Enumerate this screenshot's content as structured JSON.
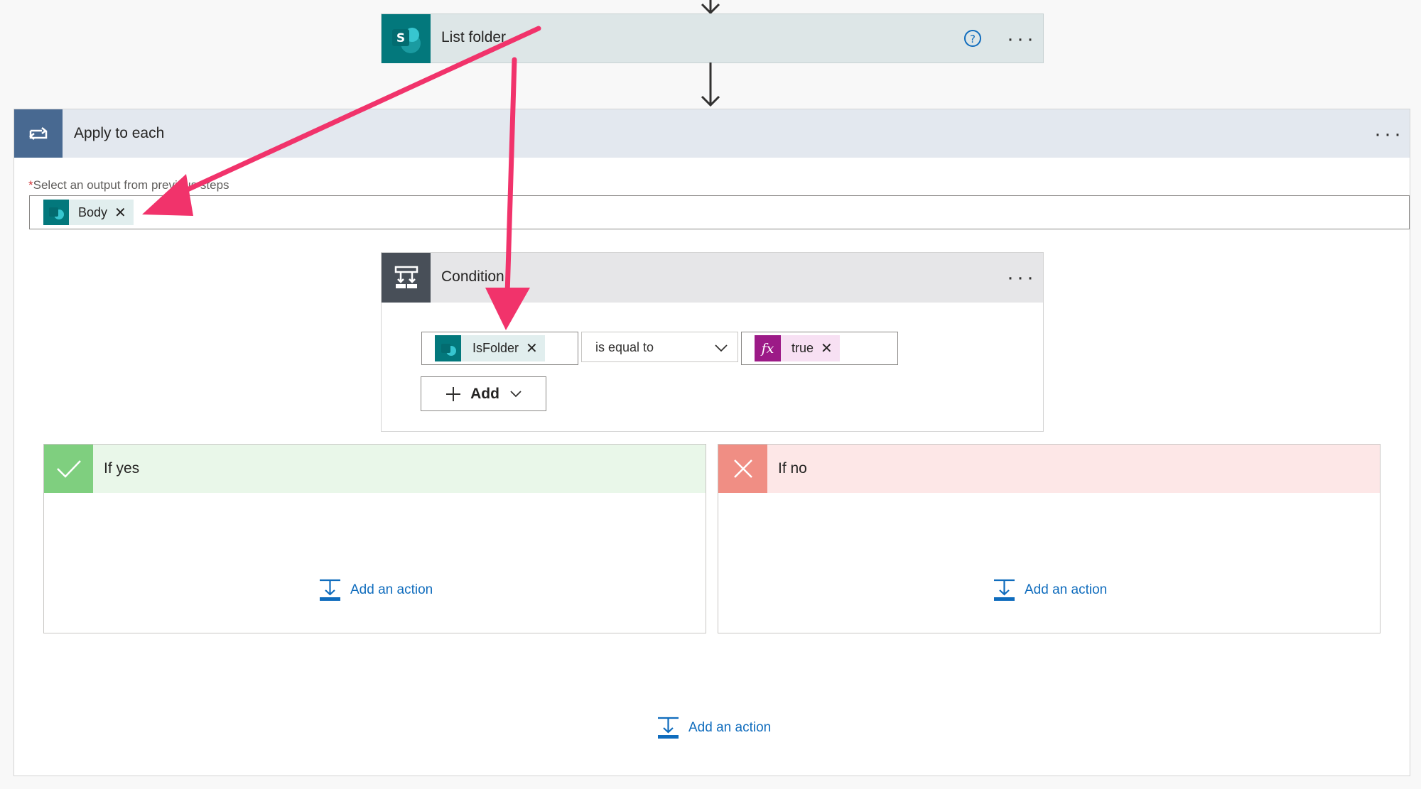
{
  "list_folder": {
    "title": "List folder",
    "logo_letter": "S"
  },
  "apply_to_each": {
    "title": "Apply to each",
    "field_label_required": "*",
    "field_label": "Select an output from previous steps",
    "token_label": "Body"
  },
  "condition": {
    "title": "Condition",
    "left_token": "IsFolder",
    "operator": "is equal to",
    "right_token": "true",
    "fx_glyph": "fx",
    "add_label": "Add"
  },
  "if_yes": {
    "title": "If yes",
    "add_action": "Add an action"
  },
  "if_no": {
    "title": "If no",
    "add_action": "Add an action"
  },
  "outer_add_action": "Add an action",
  "icons": {
    "sharepoint": "sharepoint-icon",
    "loop": "loop-icon",
    "condition": "condition-icon",
    "fx": "fx-icon",
    "check": "check-icon",
    "cross": "close-icon",
    "add_action": "add-action-icon",
    "help": "help-icon"
  },
  "colors": {
    "list_folder_header": "#dde6e7",
    "sharepoint": "#03787c",
    "apply_header": "#e3e8ef",
    "apply_icon_bg": "#486991",
    "condition_header": "#e6e6e8",
    "condition_icon_bg": "#484f58",
    "fx": "#9c1a87",
    "yes_header": "#e9f7e9",
    "yes_icon_bg": "#7fcf7f",
    "no_header": "#fde7e7",
    "no_icon_bg": "#f08e84",
    "link": "#0f6cbd",
    "annotation_arrow": "#f1336b"
  }
}
